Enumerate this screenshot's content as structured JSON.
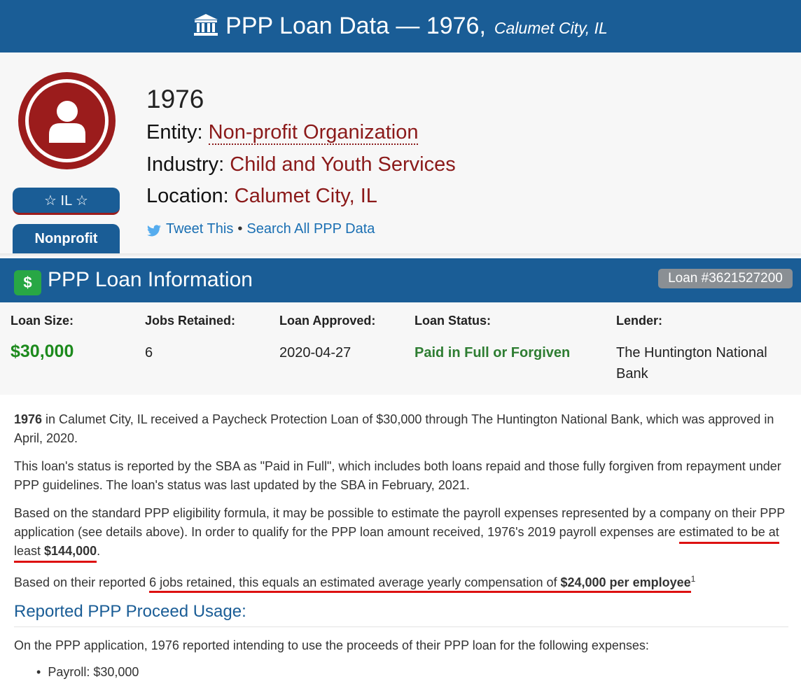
{
  "header": {
    "title": "PPP Loan Data — 1976,",
    "location": "Calumet City, IL",
    "icon": "bank-icon"
  },
  "profile": {
    "business_name": "1976",
    "entity_label": "Entity:",
    "entity_value": "Non-profit Organization",
    "industry_label": "Industry:",
    "industry_value": "Child and Youth Services",
    "location_label": "Location:",
    "location_value": "Calumet City, IL",
    "state_badge": "☆ IL ☆",
    "type_badge": "Nonprofit",
    "tweet_label": "Tweet This",
    "separator": "•",
    "search_label": "Search All PPP Data",
    "avatar_icon": "user-icon"
  },
  "loan": {
    "section_title": "PPP Loan Information",
    "dollar_symbol": "$",
    "loan_number": "Loan #3621527200",
    "stats": [
      {
        "label": "Loan Size:",
        "value": "$30,000"
      },
      {
        "label": "Jobs Retained:",
        "value": "6"
      },
      {
        "label": "Loan Approved:",
        "value": "2020-04-27"
      },
      {
        "label": "Loan Status:",
        "value": "Paid in Full or Forgiven"
      },
      {
        "label": "Lender:",
        "value": "The Huntington National Bank"
      }
    ]
  },
  "description": {
    "p1_bold": "1976",
    "p1_rest": " in Calumet City, IL received a Paycheck Protection Loan of $30,000 through The Huntington National Bank, which was approved in April, 2020.",
    "p2": "This loan's status is reported by the SBA as \"Paid in Full\", which includes both loans repaid and those fully forgiven from repayment under PPP guidelines. The loan's status was last updated by the SBA in February, 2021.",
    "p3_start": "Based on the standard PPP eligibility formula, it may be possible to estimate the payroll expenses represented by a company on their PPP application (see details above). In order to qualify for the PPP loan amount received, 1976's 2019 payroll expenses are ",
    "p3_underlined": "estimated to be at least ",
    "p3_amount": "$144,000",
    "p3_end": ".",
    "p4_start": "Based on their reported ",
    "p4_underlined": "6 jobs retained, this equals an estimated average yearly compensation of ",
    "p4_amount": "$24,000 per employee",
    "p4_footnote": "1"
  },
  "usage": {
    "heading": "Reported PPP Proceed Usage:",
    "intro": "On the PPP application, 1976 reported intending to use the proceeds of their PPP loan for the following expenses:",
    "items": [
      "Payroll: $30,000"
    ]
  },
  "colors": {
    "brand_blue": "#1a5d96",
    "accent_red": "#9b1c1c",
    "money_green": "#1d8a1d",
    "highlight_red": "#dd1111"
  }
}
